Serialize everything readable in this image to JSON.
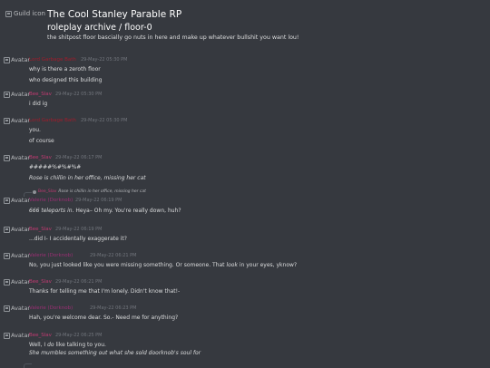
{
  "header": {
    "guild_icon_alt": "Guild icon",
    "guild_title": "The Cool Stanley Parable RP",
    "channel_name": "roleplay archive / floor-0",
    "channel_topic": "the shitpost floor bascially go nuts in here and make up whatever bullshit you want lou!"
  },
  "avatar_alt": "Avatar",
  "colors": {
    "background": "#36393f",
    "author_dark_red": "#a01c2c",
    "author_pink": "#c23a72",
    "author_magenta": "#9b2f74",
    "text": "#dcddde",
    "timestamp": "#72767d"
  },
  "messages": [
    {
      "author": "Lord Garbage Bath",
      "timestamp": "29-May-22 05:30 PM",
      "lines": [
        "why is there a zeroth floor",
        "who designed this building"
      ]
    },
    {
      "author": "Bee_Slav",
      "timestamp": "29-May-22 05:30 PM",
      "lines": [
        "i did ig"
      ]
    },
    {
      "author": "Lord Garbage Bath",
      "timestamp": "29-May-22 05:30 PM",
      "lines": [
        "you.",
        "of course"
      ]
    },
    {
      "author": "Bee_Slav",
      "timestamp": "29-May-22 06:17 PM",
      "lines": [
        "#####%#%#%#",
        "Rose is chillin in her office, missing her cat"
      ]
    },
    {
      "reply_author": "Bee_Slav",
      "reply_text": "Rose is chillin in her office, missing her cat",
      "author": "Valerie (Dorknob)",
      "timestamp": "29-May-22 06:19 PM",
      "lines": [
        "666 teleports in. Heya– Oh my. You're really down, huh?"
      ]
    },
    {
      "author": "Bee_Slav",
      "timestamp": "29-May-22 06:19 PM",
      "lines": [
        "...did I- I accidentally exaggerate it?"
      ]
    },
    {
      "author": "Valerie (Dorknob)",
      "timestamp": "29-May-22 06:21 PM",
      "lines": [
        "No, you just looked like you were missing something. Or someone. That look in your eyes, yknow?"
      ]
    },
    {
      "author": "Bee_Slav",
      "timestamp": "29-May-22 06:21 PM",
      "lines": [
        "Thanks for telling me that I'm lonely. Didn't know that!-"
      ]
    },
    {
      "author": "Valerie (Dorknob)",
      "timestamp": "29-May-22 06:23 PM",
      "lines": [
        "Hah, you're welcome dear. So.- Need me for anything?"
      ]
    },
    {
      "author": "Bee_Slav",
      "timestamp": "29-May-22 06:25 PM",
      "lines": [
        "Well, I do like talking to you.",
        "She mumbles something out what she sold doorknob's soul for"
      ]
    }
  ]
}
